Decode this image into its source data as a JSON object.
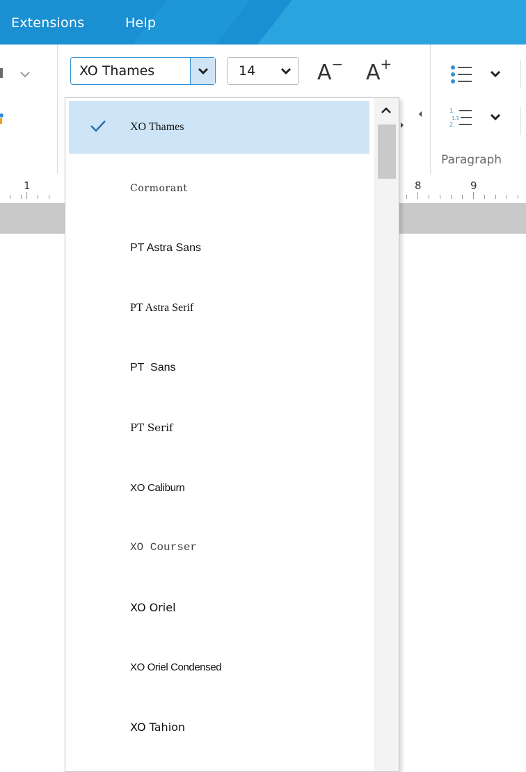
{
  "menubar": {
    "items": [
      {
        "label": "Extensions"
      },
      {
        "label": "Help"
      }
    ]
  },
  "toolbar": {
    "font_name_value": "XO Thames",
    "font_size_value": "14",
    "decrease_font_label": "A",
    "decrease_font_sup": "−",
    "increase_font_label": "A",
    "increase_font_sup": "+",
    "paragraph_group_label": "Paragraph"
  },
  "ruler": {
    "numbers": [
      "1",
      "8",
      "9"
    ]
  },
  "font_dropdown": {
    "selected": "XO Thames",
    "items": [
      {
        "label": "XO Thames"
      },
      {
        "label": "Cormorant"
      },
      {
        "label": "PT Astra Sans"
      },
      {
        "label": "PT Astra Serif"
      },
      {
        "label": "PT  Sans"
      },
      {
        "label": "PT Serif"
      },
      {
        "label": "XO Caliburn"
      },
      {
        "label": "XO Courser"
      },
      {
        "label": "XO Oriel"
      },
      {
        "label": "XO Oriel Condensed"
      },
      {
        "label": "XO Tahion"
      }
    ]
  },
  "colors": {
    "menubar": "#1a8fd1",
    "accent": "#2d8fd5",
    "selected_item": "#cde5f7"
  }
}
